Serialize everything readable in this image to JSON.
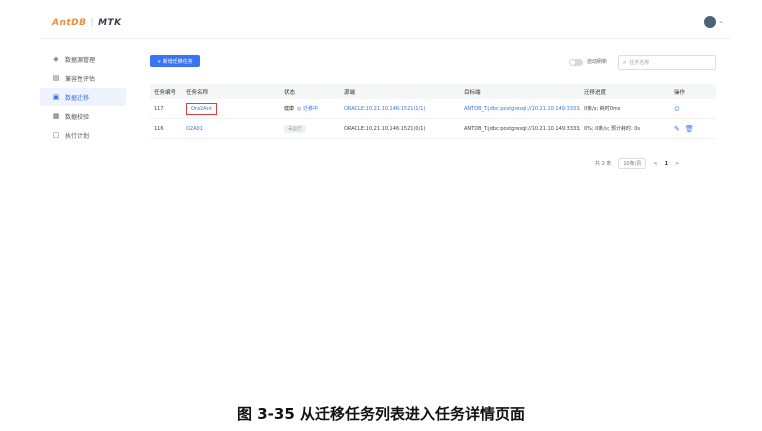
{
  "brand": {
    "logo_part1": "AntDB",
    "logo_sep": "|",
    "logo_part2": "MTK"
  },
  "sidebar": {
    "items": [
      {
        "icon": "database-icon",
        "glyph": "◈",
        "label": "数据源管理"
      },
      {
        "icon": "document-icon",
        "glyph": "▤",
        "label": "兼容性评估"
      },
      {
        "icon": "migrate-icon",
        "glyph": "▣",
        "label": "数据迁移",
        "active": true
      },
      {
        "icon": "check-icon",
        "glyph": "▦",
        "label": "数据校验"
      },
      {
        "icon": "calendar-icon",
        "glyph": "▢",
        "label": "执行计划"
      }
    ]
  },
  "toolbar": {
    "new_button": "+ 新增迁移任务",
    "auto_refresh_label": "自动刷新",
    "search_placeholder": "任务名称"
  },
  "table": {
    "headers": [
      "任务编号",
      "任务名称",
      "状态",
      "源端",
      "目标端",
      "迁移进度",
      "操作"
    ],
    "rows": [
      {
        "id": "117",
        "name": "Ora2Ant",
        "status": "健康",
        "status_extra": "◎ 迁移中",
        "source": "ORACLE:10.21.10.146:1521(1/1)",
        "target": "ANTDB_T:jdbc:postgresql://10.21.10.149:3333/...",
        "progress": "0条/s; 耗时0ms"
      },
      {
        "id": "116",
        "name": "O2A01",
        "status": "未运行",
        "status_extra": "",
        "source": "ORACLE:10.21.10.146:1521(0/1)",
        "target": "ANTDB_T:jdbc:postgresql://10.21.10.149:3333/...",
        "progress": "0%; 0条/s; 预计耗时: 0s"
      }
    ]
  },
  "pagination": {
    "total": "共 2 条",
    "page_size": "10条/页",
    "prev": "<",
    "current": "1",
    "next": ">"
  },
  "caption": "图 3-35  从迁移任务列表进入任务详情页面"
}
